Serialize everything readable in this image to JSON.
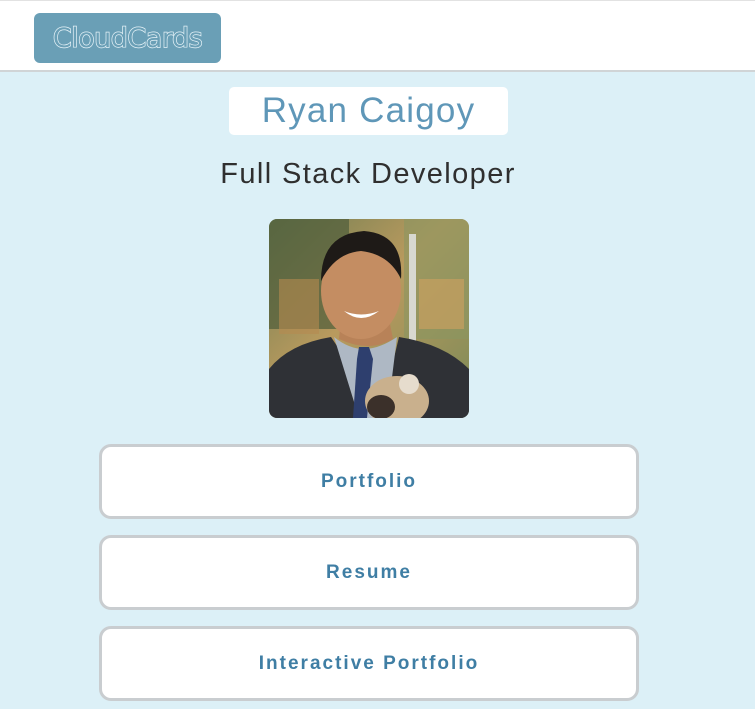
{
  "header": {
    "logo_text": "CloudCards"
  },
  "profile": {
    "name": "Ryan Caigoy",
    "title": "Full Stack Developer",
    "photo_icon": "profile-photo"
  },
  "links": [
    {
      "label": "Portfolio"
    },
    {
      "label": "Resume"
    },
    {
      "label": "Interactive Portfolio"
    }
  ],
  "colors": {
    "page_background": "#dcf0f7",
    "logo_background": "#6a9fb6",
    "name_text": "#5f97b8",
    "button_text": "#3f7ea4",
    "button_border": "#c9cdd0"
  }
}
